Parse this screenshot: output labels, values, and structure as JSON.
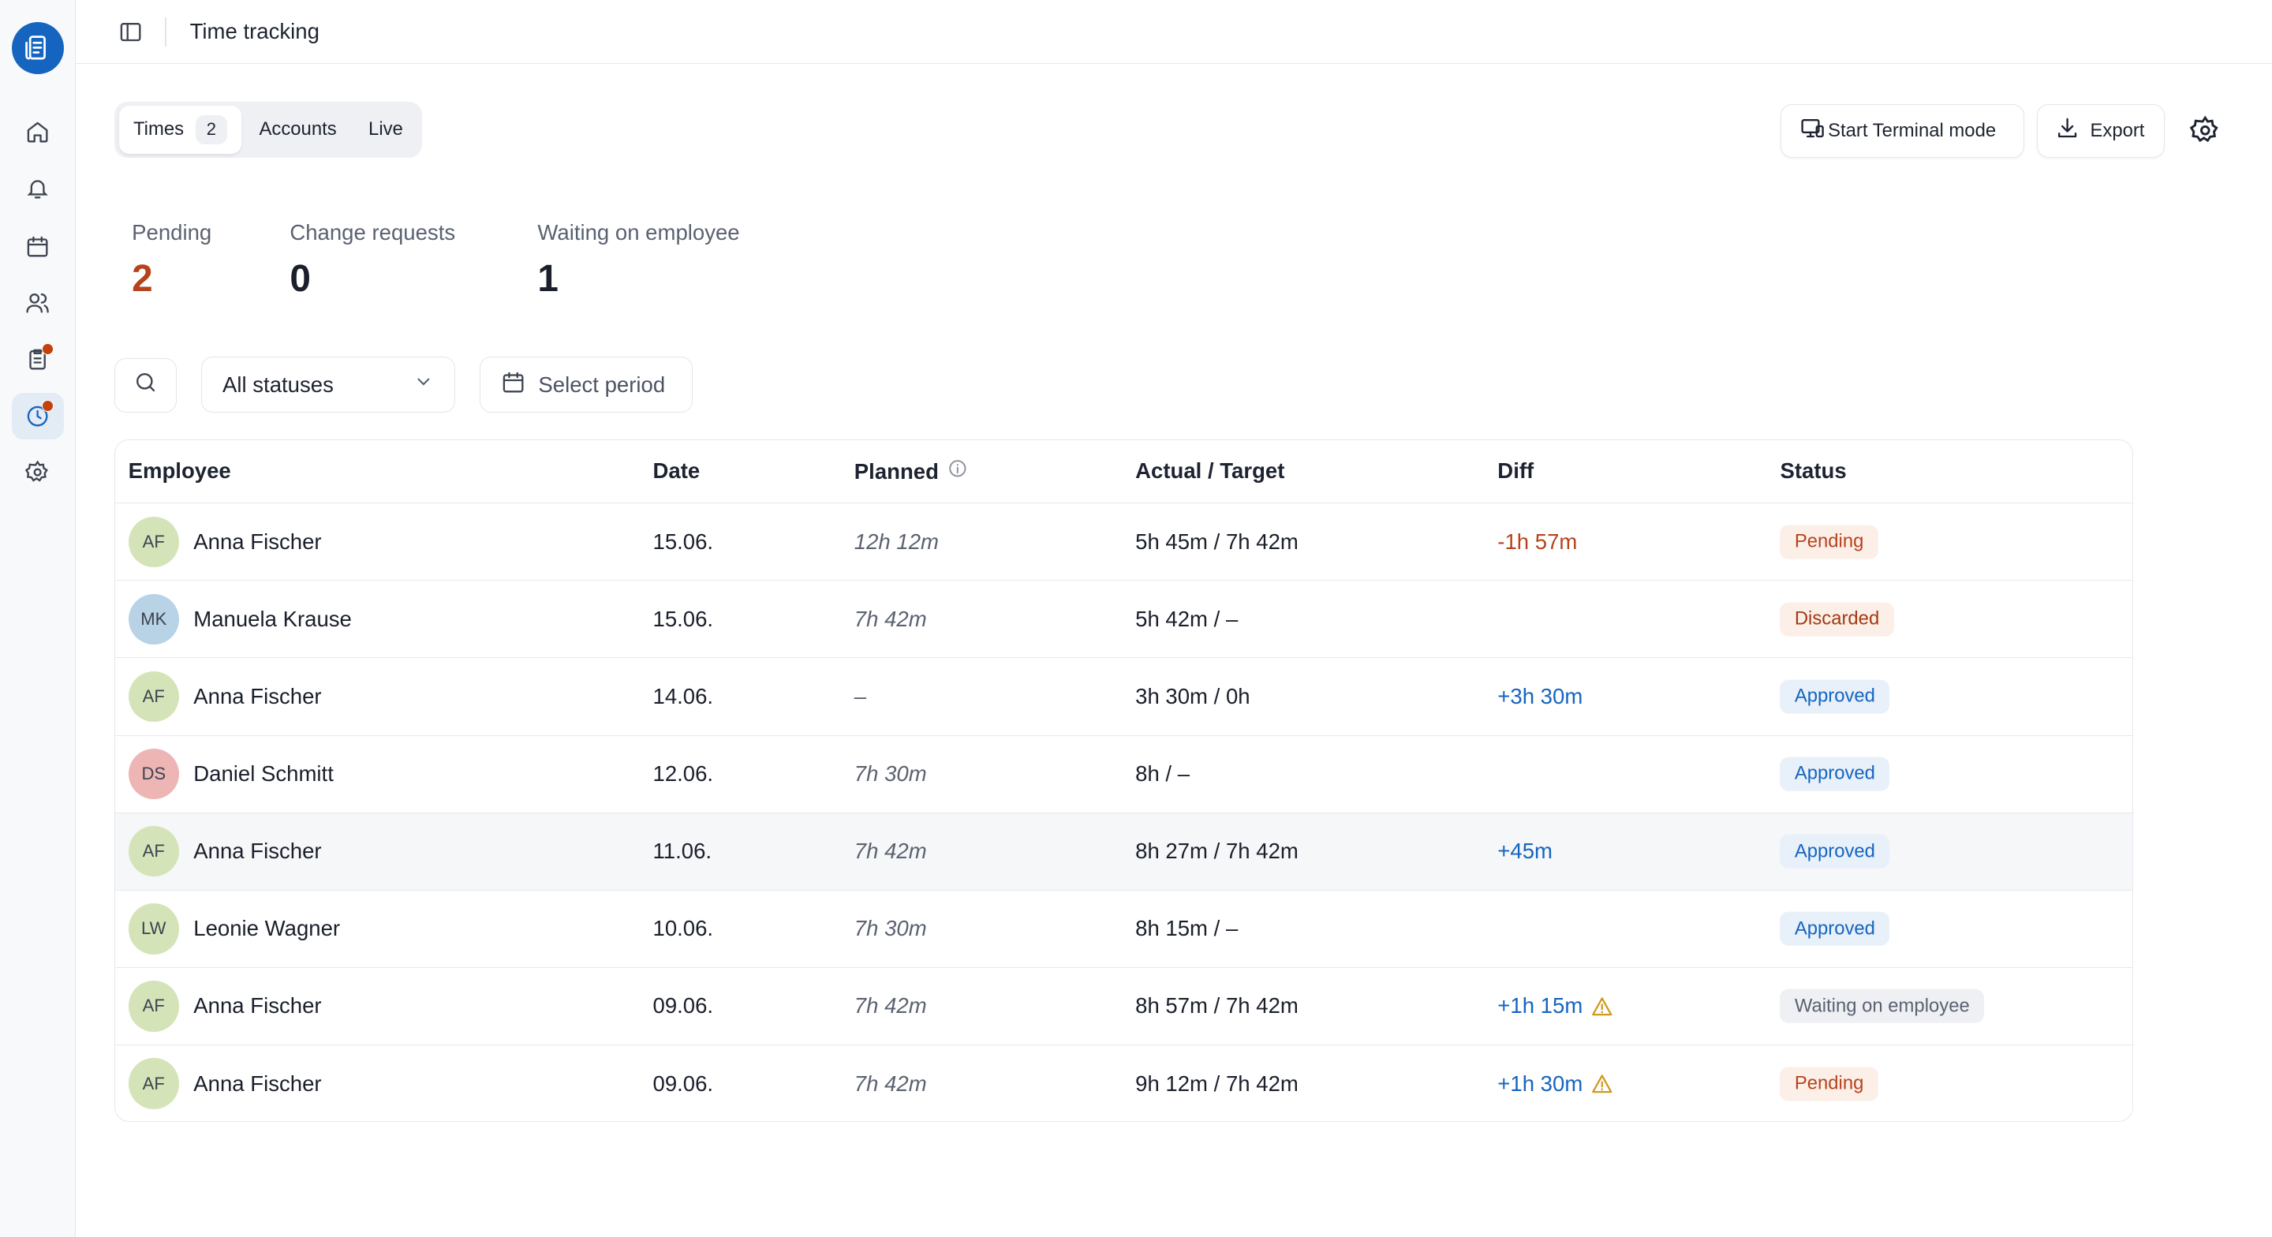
{
  "header": {
    "title": "Time tracking"
  },
  "tabs": [
    {
      "label": "Times",
      "count": "2"
    },
    {
      "label": "Accounts"
    },
    {
      "label": "Live"
    }
  ],
  "actions": {
    "terminal_label": "Start Terminal mode",
    "export_label": "Export"
  },
  "stats": [
    {
      "label": "Pending",
      "value": "2"
    },
    {
      "label": "Change requests",
      "value": "0"
    },
    {
      "label": "Waiting on employee",
      "value": "1"
    }
  ],
  "filters": {
    "status_value": "All statuses",
    "period_label": "Select period"
  },
  "table": {
    "columns": {
      "employee": "Employee",
      "date": "Date",
      "planned": "Planned",
      "actual": "Actual / Target",
      "diff": "Diff",
      "status": "Status"
    },
    "rows": [
      {
        "initials": "AF",
        "name": "Anna Fischer",
        "date": "15.06.",
        "planned": "12h 12m",
        "actual": "5h 45m / 7h 42m",
        "diff": "-1h 57m",
        "status": "Pending"
      },
      {
        "initials": "MK",
        "name": "Manuela Krause",
        "date": "15.06.",
        "planned": "7h 42m",
        "actual": "5h 42m / –",
        "diff": "",
        "status": "Discarded"
      },
      {
        "initials": "AF",
        "name": "Anna Fischer",
        "date": "14.06.",
        "planned": "–",
        "actual": "3h 30m / 0h",
        "diff": "+3h 30m",
        "status": "Approved"
      },
      {
        "initials": "DS",
        "name": "Daniel Schmitt",
        "date": "12.06.",
        "planned": "7h 30m",
        "actual": "8h / –",
        "diff": "",
        "status": "Approved"
      },
      {
        "initials": "AF",
        "name": "Anna Fischer",
        "date": "11.06.",
        "planned": "7h 42m",
        "actual": "8h 27m / 7h 42m",
        "diff": "+45m",
        "status": "Approved"
      },
      {
        "initials": "LW",
        "name": "Leonie Wagner",
        "date": "10.06.",
        "planned": "7h 30m",
        "actual": "8h 15m / –",
        "diff": "",
        "status": "Approved"
      },
      {
        "initials": "AF",
        "name": "Anna Fischer",
        "date": "09.06.",
        "planned": "7h 42m",
        "actual": "8h 57m / 7h 42m",
        "diff": "+1h 15m",
        "status": "Waiting on employee"
      },
      {
        "initials": "AF",
        "name": "Anna Fischer",
        "date": "09.06.",
        "planned": "7h 42m",
        "actual": "9h 12m / 7h 42m",
        "diff": "+1h 30m",
        "status": "Pending"
      }
    ]
  },
  "colors": {
    "accent": "#1565c0",
    "negative_diff": "#b7431c",
    "positive_diff": "#1565c0",
    "pending_bg": "#fbefe7",
    "pending_fg": "#b7431c",
    "discarded_bg": "#fbefe7",
    "discarded_fg": "#a33a14",
    "approved_bg": "#e8f0f9",
    "approved_fg": "#1565c0",
    "waiting_bg": "#eef0f3",
    "waiting_fg": "#5a6272",
    "avatar_af": "#d5e4b8",
    "avatar_mk": "#b8d3e6",
    "avatar_ds": "#eeb5b5",
    "avatar_lw": "#d5e4b8"
  }
}
